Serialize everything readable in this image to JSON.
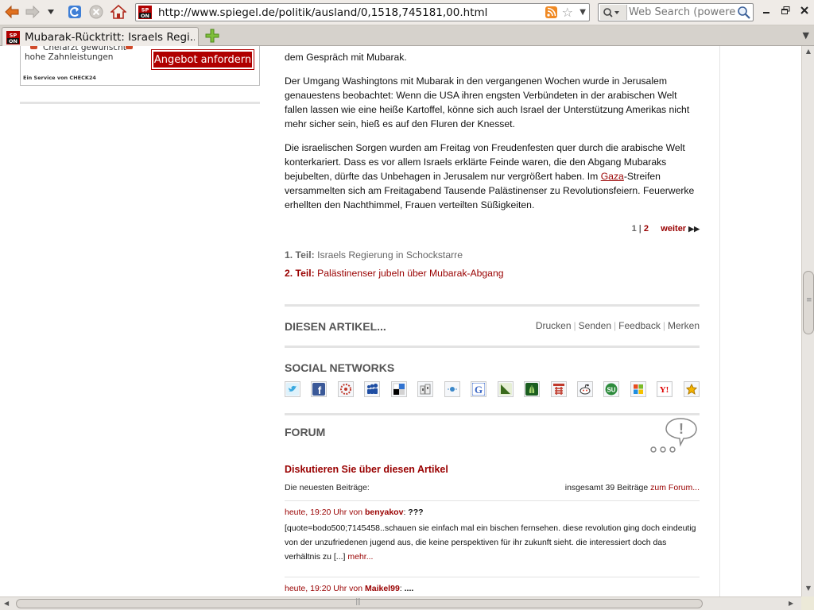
{
  "browser": {
    "url": "http://www.spiegel.de/politik/ausland/0,1518,745181,00.html",
    "search_placeholder": "Web Search (powered",
    "tab_title": "Mubarak-Rücktritt: Israels Regi...",
    "favicon_text": "SP ON"
  },
  "ad": {
    "line1": "Chefarzt gewünscht",
    "line2": "hohe Zahnleistungen",
    "cta": "Angebot anfordern",
    "service": "Ein Service von CHECK24"
  },
  "article": {
    "p0": "dem Gespräch mit Mubarak.",
    "p1": "Der Umgang Washingtons mit Mubarak in den vergangenen Wochen wurde in Jerusalem genauestens beobachtet: Wenn die USA ihren engsten Verbündeten in der arabischen Welt fallen lassen wie eine heiße Kartoffel, könne sich auch Israel der Unterstützung Amerikas nicht mehr sicher sein, hieß es auf den Fluren der Knesset.",
    "p2_before": "Die israelischen Sorgen wurden am Freitag von Freudenfesten quer durch die arabische Welt konterkariert. Dass es vor allem Israels erklärte Feinde waren, die den Abgang Mubaraks bejubelten, dürfte das Unbehagen in Jerusalem nur vergrößert haben. Im ",
    "p2_link": "Gaza",
    "p2_after": "-Streifen versammelten sich am Freitagabend Tausende Palästinenser zu Revolutionsfeiern. Feuerwerke erhellten den Nachthimmel, Frauen verteilten Süßigkeiten."
  },
  "pager": {
    "page1": "1",
    "sep": "|",
    "page2": "2",
    "next": "weiter"
  },
  "parts": [
    {
      "label": "1. Teil:",
      "title": "Israels Regierung in Schockstarre"
    },
    {
      "label": "2. Teil:",
      "title": "Palästinenser jubeln über Mubarak-Abgang"
    }
  ],
  "article_actions": {
    "title": "DIESEN ARTIKEL...",
    "items": [
      "Drucken",
      "Senden",
      "Feedback",
      "Merken"
    ]
  },
  "social": {
    "title": "SOCIAL NETWORKS",
    "icons": [
      "twitter-icon",
      "facebook-icon",
      "linkarena-icon",
      "myspace-icon",
      "delicious-icon",
      "digg-icon",
      "mrwong-icon",
      "google-icon",
      "yigg-icon",
      "webnews-icon",
      "folkd-icon",
      "reddit-icon",
      "stumbleupon-icon",
      "windows-live-icon",
      "yahoo-icon",
      "favoriten-icon"
    ]
  },
  "forum": {
    "title": "FORUM",
    "discuss": "Diskutieren Sie über diesen Artikel",
    "newest": "Die neuesten Beiträge:",
    "total": "insgesamt 39 Beiträge",
    "to_forum": "zum Forum...",
    "posts": [
      {
        "time": "heute, 19:20 Uhr von",
        "author": "benyakov",
        "title": "???",
        "body": "[quote=bodo500;7145458..schauen sie einfach mal ein bischen fernsehen. diese revolution ging doch eindeutig von der unzufriedenen jugend aus, die keine perspektiven für ihr zukunft sieht. die interessiert doch das verhältnis zu [...] ",
        "more": "mehr..."
      },
      {
        "time": "heute, 19:20 Uhr von",
        "author": "Maikel99",
        "title": "...."
      }
    ]
  }
}
